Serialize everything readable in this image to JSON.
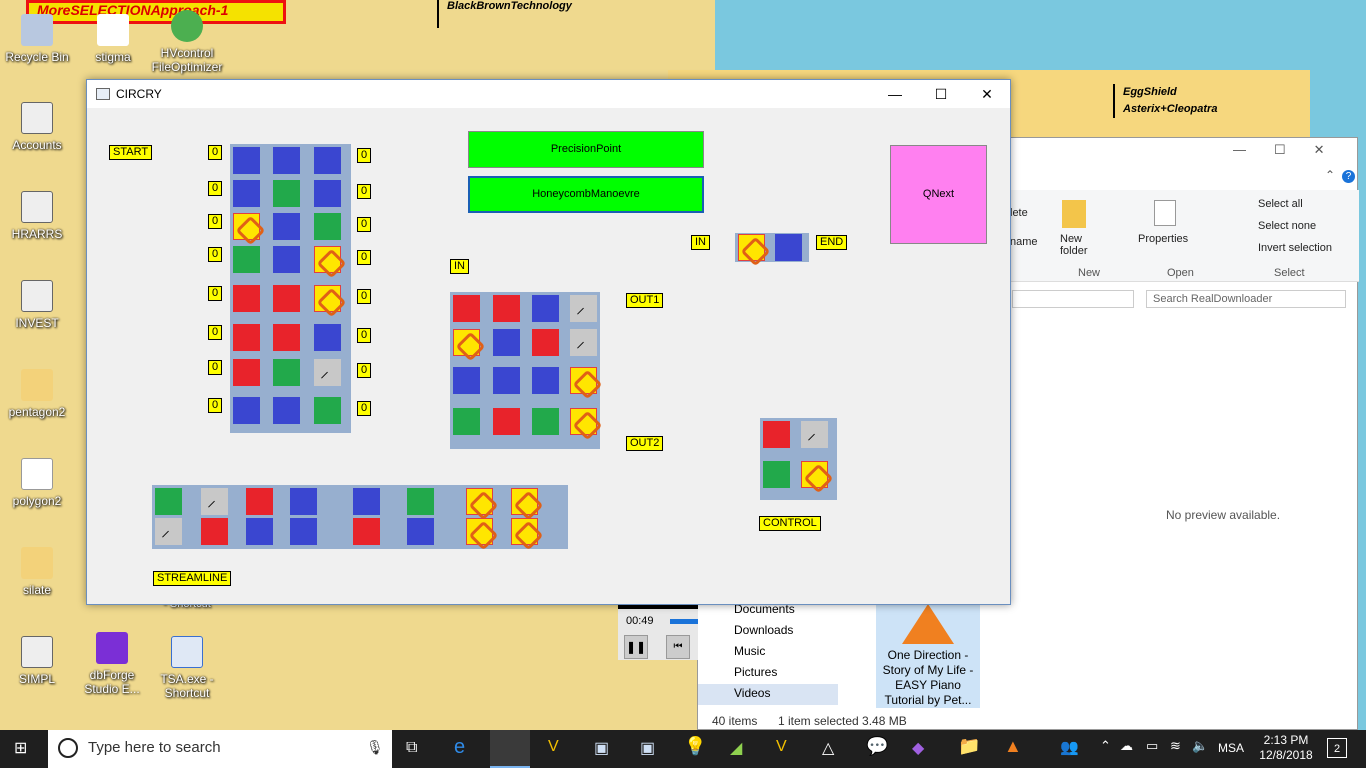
{
  "desktop": {
    "banner": "MoreSELECTIONApproach-1",
    "top_labels": [
      "BlackBrownTechnology",
      "EggShield",
      "Asterix+Cleopatra"
    ],
    "icons": [
      {
        "label": "Recycle Bin",
        "icon": "recycle-bin-icon"
      },
      {
        "label": "stigma",
        "icon": "file-icon"
      },
      {
        "label": "HVcontrol\nFileOptimizer",
        "icon": "app-icon"
      },
      {
        "label": "Accounts",
        "icon": "vs-project-icon"
      },
      {
        "label": "HRARRS",
        "icon": "vs-project-icon"
      },
      {
        "label": "INVEST",
        "icon": "vs-project-icon"
      },
      {
        "label": "pentagon2",
        "icon": "folder-icon"
      },
      {
        "label": "polygon2",
        "icon": "ie-file-icon"
      },
      {
        "label": "silate",
        "icon": "folder-icon"
      },
      {
        "label": "SIMPL",
        "icon": "vs-project-icon"
      },
      {
        "label": "dbForge Studio E...",
        "icon": "dbforge-icon"
      },
      {
        "label": "TSA.exe - Shortcut",
        "icon": "exe-icon"
      },
      {
        "label": "- Shortcut",
        "icon": "shortcut-icon"
      }
    ]
  },
  "circry": {
    "title": "CIRCRY",
    "start": "START",
    "streamline": "STREAMLINE",
    "in1": "IN",
    "in2": "IN",
    "out1": "OUT1",
    "out2": "OUT2",
    "end": "END",
    "control": "CONTROL",
    "zero": "0",
    "btn_precision": "PrecisionPoint",
    "btn_honeycomb": "HoneycombManoevre",
    "btn_qnext": "QNext"
  },
  "explorer": {
    "ribbon": {
      "delete": "lete",
      "rename": "name",
      "new_folder": "New folder",
      "new_group": "New",
      "properties": "Properties",
      "open_group": "Open",
      "select_all": "Select all",
      "select_none": "Select none",
      "invert": "Invert selection",
      "select_group": "Select"
    },
    "search_placeholder": "Search RealDownloader",
    "preview": "No preview available.",
    "nav": [
      "Documents",
      "Downloads",
      "Music",
      "Pictures",
      "Videos"
    ],
    "file_label": "One Direction - Story of My Life - EASY Piano Tutorial by Pet...",
    "status_items": "40 items",
    "status_selected": "1 item selected  3.48 MB"
  },
  "media": {
    "time": "00:49"
  },
  "taskbar": {
    "search_placeholder": "Type here to search",
    "lang": "MSA",
    "time": "2:13 PM",
    "date": "12/8/2018",
    "notif": "2"
  }
}
